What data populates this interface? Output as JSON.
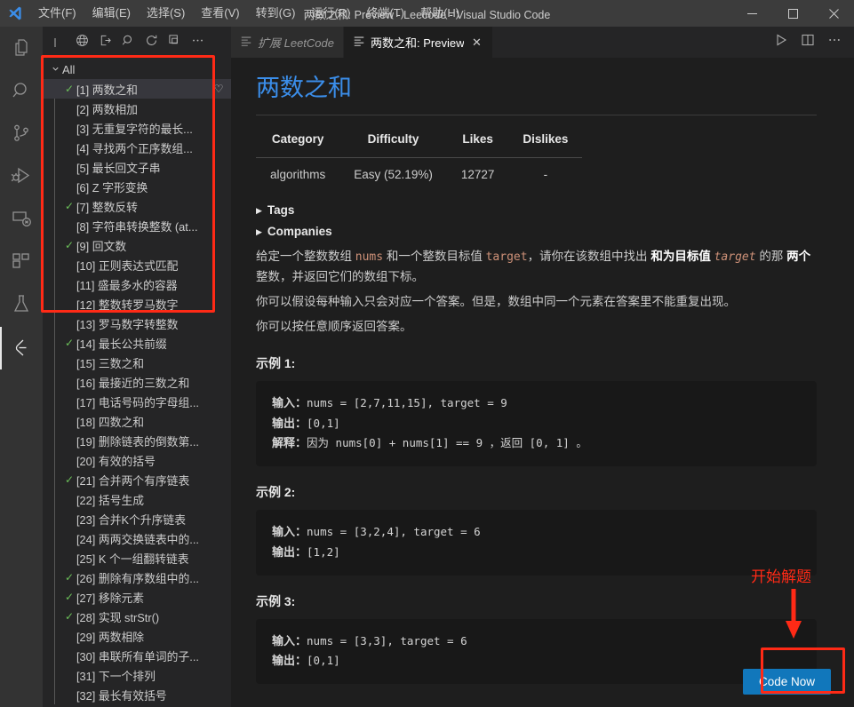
{
  "window": {
    "title": "两数之和: Preview - Leecode - Visual Studio Code",
    "logo": "vscode-logo",
    "minimize": "−",
    "maximize": "▢",
    "close": "✕"
  },
  "menubar": {
    "items": [
      {
        "label": "文件(F)",
        "name": "menu-file"
      },
      {
        "label": "编辑(E)",
        "name": "menu-edit"
      },
      {
        "label": "选择(S)",
        "name": "menu-selection"
      },
      {
        "label": "查看(V)",
        "name": "menu-view"
      },
      {
        "label": "转到(G)",
        "name": "menu-go"
      },
      {
        "label": "运行(R)",
        "name": "menu-run"
      },
      {
        "label": "终端(T)",
        "name": "menu-terminal"
      },
      {
        "label": "帮助(H)",
        "name": "menu-help"
      }
    ]
  },
  "activitybar": {
    "items": [
      {
        "icon": "files-explorer-icon",
        "active": false
      },
      {
        "icon": "search-icon",
        "active": false
      },
      {
        "icon": "source-control-icon",
        "active": false
      },
      {
        "icon": "run-and-debug-icon",
        "active": false
      },
      {
        "icon": "remote-explorer-icon",
        "active": false
      },
      {
        "icon": "extensions-icon",
        "active": false
      },
      {
        "icon": "testing-flask-icon",
        "active": false
      },
      {
        "icon": "leetcode-icon",
        "active": true
      }
    ]
  },
  "sidebar": {
    "toolbar": [
      {
        "icon": "endpoint-globe-icon",
        "title": "切换终端节点"
      },
      {
        "icon": "sign-in-icon",
        "title": "登录"
      },
      {
        "icon": "search-icon",
        "title": "搜索"
      },
      {
        "icon": "refresh-icon",
        "title": "刷新"
      },
      {
        "icon": "collapse-all-icon",
        "title": "全部折叠"
      },
      {
        "icon": "more-actions-icon",
        "title": "更多操作..."
      }
    ],
    "group": {
      "label": "All",
      "expanded": true,
      "chevron": "⌄"
    },
    "items": [
      {
        "label": "[1] 两数之和",
        "solved": true,
        "favorite": true,
        "selected": true
      },
      {
        "label": "[2] 两数相加",
        "solved": false,
        "favorite": false,
        "selected": false
      },
      {
        "label": "[3] 无重复字符的最长...",
        "solved": false,
        "favorite": false,
        "selected": false
      },
      {
        "label": "[4] 寻找两个正序数组...",
        "solved": false,
        "favorite": false,
        "selected": false
      },
      {
        "label": "[5] 最长回文子串",
        "solved": false,
        "favorite": false,
        "selected": false
      },
      {
        "label": "[6] Z 字形变换",
        "solved": false,
        "favorite": false,
        "selected": false
      },
      {
        "label": "[7] 整数反转",
        "solved": true,
        "favorite": false,
        "selected": false
      },
      {
        "label": "[8] 字符串转换整数 (at...",
        "solved": false,
        "favorite": false,
        "selected": false
      },
      {
        "label": "[9] 回文数",
        "solved": true,
        "favorite": false,
        "selected": false
      },
      {
        "label": "[10] 正则表达式匹配",
        "solved": false,
        "favorite": false,
        "selected": false
      },
      {
        "label": "[11] 盛最多水的容器",
        "solved": false,
        "favorite": false,
        "selected": false
      },
      {
        "label": "[12] 整数转罗马数字",
        "solved": false,
        "favorite": false,
        "selected": false
      },
      {
        "label": "[13] 罗马数字转整数",
        "solved": false,
        "favorite": false,
        "selected": false
      },
      {
        "label": "[14] 最长公共前缀",
        "solved": true,
        "favorite": false,
        "selected": false
      },
      {
        "label": "[15] 三数之和",
        "solved": false,
        "favorite": false,
        "selected": false
      },
      {
        "label": "[16] 最接近的三数之和",
        "solved": false,
        "favorite": false,
        "selected": false
      },
      {
        "label": "[17] 电话号码的字母组...",
        "solved": false,
        "favorite": false,
        "selected": false
      },
      {
        "label": "[18] 四数之和",
        "solved": false,
        "favorite": false,
        "selected": false
      },
      {
        "label": "[19] 删除链表的倒数第...",
        "solved": false,
        "favorite": false,
        "selected": false
      },
      {
        "label": "[20] 有效的括号",
        "solved": false,
        "favorite": false,
        "selected": false
      },
      {
        "label": "[21] 合并两个有序链表",
        "solved": true,
        "favorite": false,
        "selected": false
      },
      {
        "label": "[22] 括号生成",
        "solved": false,
        "favorite": false,
        "selected": false
      },
      {
        "label": "[23] 合并K个升序链表",
        "solved": false,
        "favorite": false,
        "selected": false
      },
      {
        "label": "[24] 两两交换链表中的...",
        "solved": false,
        "favorite": false,
        "selected": false
      },
      {
        "label": "[25] K 个一组翻转链表",
        "solved": false,
        "favorite": false,
        "selected": false
      },
      {
        "label": "[26] 删除有序数组中的...",
        "solved": true,
        "favorite": false,
        "selected": false
      },
      {
        "label": "[27] 移除元素",
        "solved": true,
        "favorite": false,
        "selected": false
      },
      {
        "label": "[28] 实现 strStr()",
        "solved": true,
        "favorite": false,
        "selected": false
      },
      {
        "label": "[29] 两数相除",
        "solved": false,
        "favorite": false,
        "selected": false
      },
      {
        "label": "[30] 串联所有单词的子...",
        "solved": false,
        "favorite": false,
        "selected": false
      },
      {
        "label": "[31] 下一个排列",
        "solved": false,
        "favorite": false,
        "selected": false
      },
      {
        "label": "[32] 最长有效括号",
        "solved": false,
        "favorite": false,
        "selected": false
      }
    ]
  },
  "tabs": [
    {
      "label": "扩展 LeetCode",
      "active": false,
      "closable": false,
      "icon": "preview-icon"
    },
    {
      "label": "两数之和: Preview",
      "active": true,
      "closable": true,
      "icon": "preview-icon",
      "close": "✕"
    }
  ],
  "tab_actions": [
    {
      "icon": "run-play-icon"
    },
    {
      "icon": "split-editor-icon"
    },
    {
      "icon": "more-actions-icon"
    }
  ],
  "preview": {
    "title": "两数之和",
    "table": {
      "headers": [
        "Category",
        "Difficulty",
        "Likes",
        "Dislikes"
      ],
      "rows": [
        [
          "algorithms",
          "Easy (52.19%)",
          "12727",
          "-"
        ]
      ]
    },
    "collapsibles": [
      {
        "label": "Tags",
        "triangle": "▶"
      },
      {
        "label": "Companies",
        "triangle": "▶"
      }
    ],
    "description_1_parts": [
      {
        "t": "给定一个整数数组 ",
        "s": "plain"
      },
      {
        "t": "nums",
        "s": "code"
      },
      {
        "t": " 和一个整数目标值 ",
        "s": "plain"
      },
      {
        "t": "target",
        "s": "code"
      },
      {
        "t": "，请你在该数组中找出 ",
        "s": "plain"
      },
      {
        "t": "和为目标值",
        "s": "bold"
      },
      {
        "t": " ",
        "s": "plain"
      },
      {
        "t": "target",
        "s": "code-italic"
      },
      {
        "t": " 的那 ",
        "s": "plain"
      },
      {
        "t": "两个",
        "s": "bold"
      },
      {
        "t": " 整数，并返回它们的数组下标。",
        "s": "plain"
      }
    ],
    "description_2": "你可以假设每种输入只会对应一个答案。但是，数组中同一个元素在答案里不能重复出现。",
    "description_3": "你可以按任意顺序返回答案。",
    "examples": [
      {
        "title": "示例 1:",
        "lines": [
          {
            "key": "输入：",
            "val": "nums = [2,7,11,15], target = 9"
          },
          {
            "key": "输出：",
            "val": "[0,1]"
          },
          {
            "key": "解释：",
            "val": "因为 nums[0] + nums[1] == 9 ，返回 [0, 1] 。"
          }
        ]
      },
      {
        "title": "示例 2:",
        "lines": [
          {
            "key": "输入：",
            "val": "nums = [3,2,4], target = 6"
          },
          {
            "key": "输出：",
            "val": "[1,2]"
          }
        ]
      },
      {
        "title": "示例 3:",
        "lines": [
          {
            "key": "输入：",
            "val": "nums = [3,3], target = 6"
          },
          {
            "key": "输出：",
            "val": "[0,1]"
          }
        ]
      }
    ],
    "code_now_label": "Code Now"
  },
  "annotations": {
    "start_solving_label": "开始解题",
    "highlight_color": "#ff2a16"
  }
}
